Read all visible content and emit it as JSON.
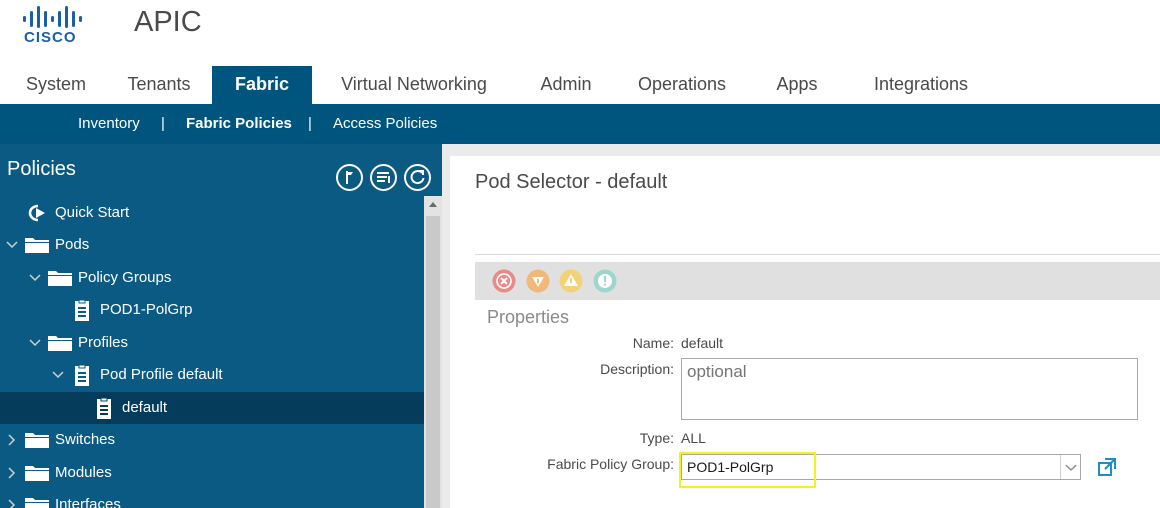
{
  "header": {
    "logo_text": "CISCO",
    "app_title": "APIC"
  },
  "tabs": [
    {
      "label": "System"
    },
    {
      "label": "Tenants"
    },
    {
      "label": "Fabric"
    },
    {
      "label": "Virtual Networking"
    },
    {
      "label": "Admin"
    },
    {
      "label": "Operations"
    },
    {
      "label": "Apps"
    },
    {
      "label": "Integrations"
    }
  ],
  "subnav": {
    "items": [
      {
        "label": "Inventory"
      },
      {
        "label": "Fabric Policies"
      },
      {
        "label": "Access Policies"
      }
    ],
    "separator": "|"
  },
  "sidebar": {
    "title": "Policies",
    "tree": [
      {
        "label": "Quick Start",
        "icon": "quick-start-icon"
      },
      {
        "label": "Pods",
        "icon": "folder-icon"
      },
      {
        "label": "Policy Groups",
        "icon": "folder-icon"
      },
      {
        "label": "POD1-PolGrp",
        "icon": "document-icon"
      },
      {
        "label": "Profiles",
        "icon": "folder-icon"
      },
      {
        "label": "Pod Profile default",
        "icon": "document-icon"
      },
      {
        "label": "default",
        "icon": "document-icon"
      },
      {
        "label": "Switches",
        "icon": "folder-icon"
      },
      {
        "label": "Modules",
        "icon": "folder-icon"
      },
      {
        "label": "Interfaces",
        "icon": "folder-icon"
      }
    ]
  },
  "main": {
    "title": "Pod Selector - default",
    "section": "Properties",
    "fields": {
      "name_label": "Name:",
      "name_value": "default",
      "description_label": "Description:",
      "description_placeholder": "optional",
      "type_label": "Type:",
      "type_value": "ALL",
      "fabric_policy_group_label": "Fabric Policy Group:",
      "fabric_policy_group_value": "POD1-PolGrp"
    }
  },
  "colors": {
    "brand_blue": "#00557f",
    "highlight": "#f5f21b",
    "fault_critical": "#e88b88",
    "fault_major": "#f2b87a",
    "fault_minor": "#f3d179",
    "fault_warning": "#9fd5cd"
  }
}
